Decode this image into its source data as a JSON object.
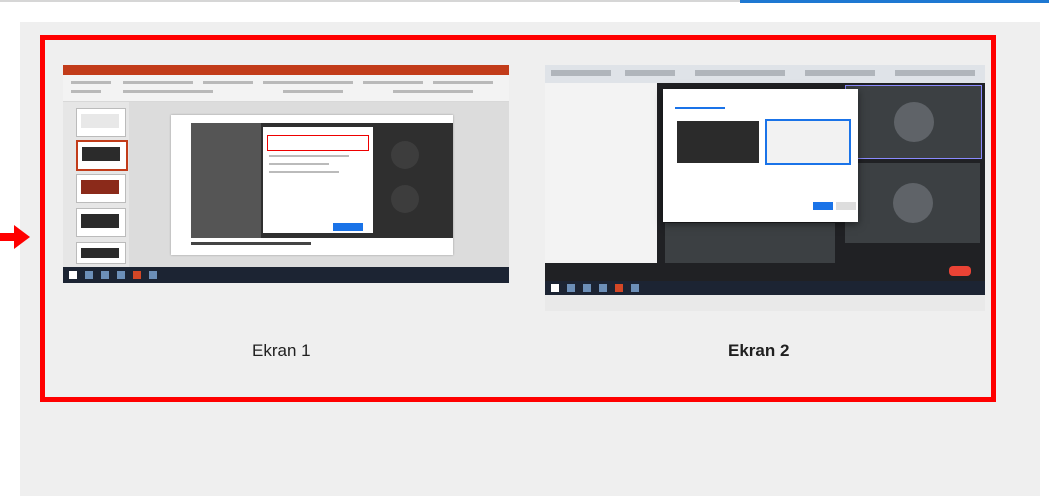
{
  "screens": [
    {
      "label": "Ekran 1",
      "selected": false
    },
    {
      "label": "Ekran 2",
      "selected": true
    }
  ],
  "colors": {
    "highlight": "#ff0000",
    "accent": "#1e78d2",
    "panel_background": "#efefef"
  },
  "icons": {
    "pointer": "arrow-right-icon"
  }
}
